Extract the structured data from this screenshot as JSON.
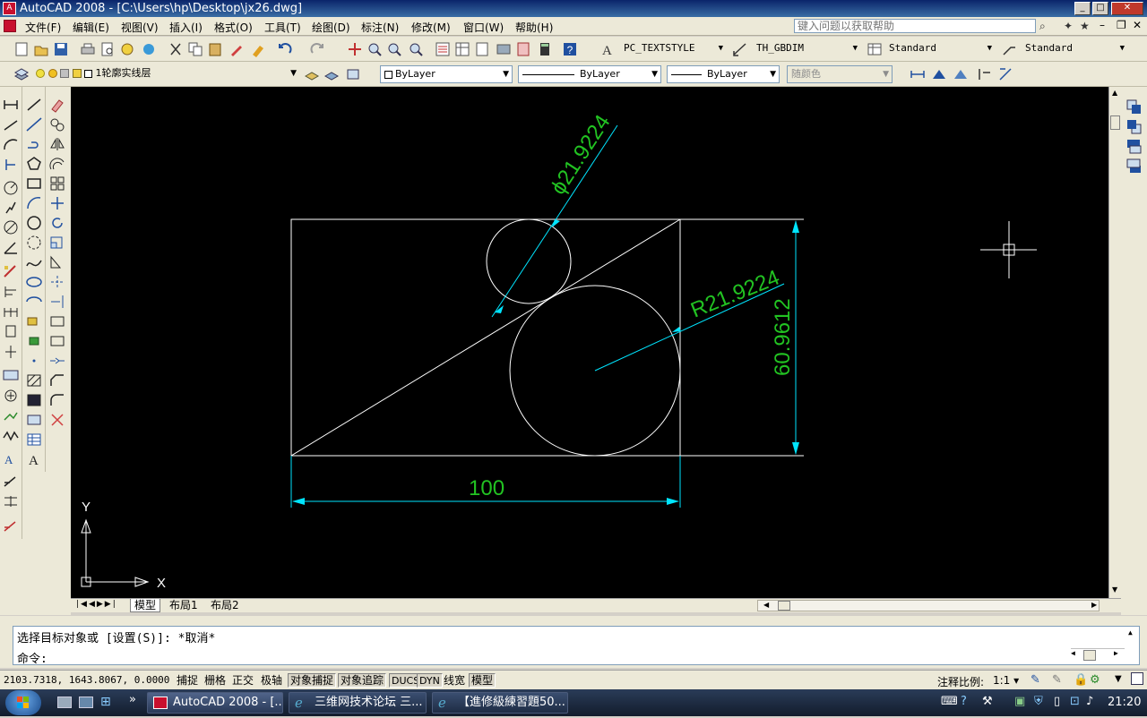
{
  "window": {
    "title": "AutoCAD 2008 - [C:\\Users\\hp\\Desktop\\jx26.dwg]"
  },
  "menu": {
    "items": [
      "文件(F)",
      "编辑(E)",
      "视图(V)",
      "插入(I)",
      "格式(O)",
      "工具(T)",
      "绘图(D)",
      "标注(N)",
      "修改(M)",
      "窗口(W)",
      "帮助(H)"
    ],
    "help_placeholder": "键入问题以获取帮助"
  },
  "styles_toolbar": {
    "text_style": "PC_TEXTSTYLE",
    "dim_style": "TH_GBDIM",
    "table_style": "Standard",
    "multileader_style": "Standard"
  },
  "layers_toolbar": {
    "current_layer": "1轮廓实线层",
    "color": "ByLayer",
    "linetype": "ByLayer",
    "lineweight": "ByLayer",
    "plot_style": "随颜色"
  },
  "drawing": {
    "dimensions": {
      "diameter": "ϕ21.9224",
      "radius": "R21.9224",
      "height": "60.9612",
      "width": "100"
    },
    "ucs": {
      "x_label": "X",
      "y_label": "Y"
    },
    "colors": {
      "geometry": "#ffffff",
      "dimension_lines": "#00e5ff",
      "dimension_text": "#22c322",
      "background": "#000000"
    }
  },
  "layout_tabs": [
    "模型",
    "布局1",
    "布局2"
  ],
  "command": {
    "history": "选择目标对象或 [设置(S)]: *取消*",
    "prompt": "命令:"
  },
  "status": {
    "coordinates": "2103.7318, 1643.8067, 0.0000",
    "toggles": [
      {
        "label": "捕捉",
        "on": false
      },
      {
        "label": "栅格",
        "on": false
      },
      {
        "label": "正交",
        "on": false
      },
      {
        "label": "极轴",
        "on": false
      },
      {
        "label": "对象捕捉",
        "on": true
      },
      {
        "label": "对象追踪",
        "on": true
      },
      {
        "label": "DUCS",
        "on": true
      },
      {
        "label": "DYN",
        "on": true
      },
      {
        "label": "线宽",
        "on": false
      },
      {
        "label": "模型",
        "on": true
      }
    ],
    "annotation_scale_label": "注释比例:",
    "annotation_scale": "1:1"
  },
  "taskbar": {
    "items": [
      "AutoCAD 2008 - [...",
      "三维网技术论坛 三...",
      "【進修級練習題50..."
    ],
    "clock": "21:20"
  }
}
